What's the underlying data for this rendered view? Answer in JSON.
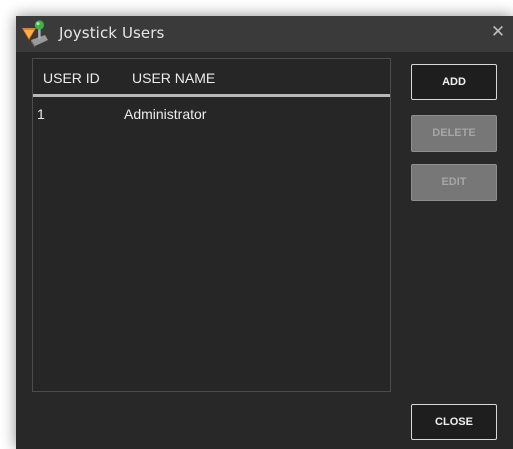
{
  "window": {
    "title": "Joystick Users",
    "close_glyph": "✕",
    "app_icon": "joystick-icon"
  },
  "user_list": {
    "columns": [
      "USER ID",
      "USER NAME"
    ],
    "rows": [
      {
        "user_id": "1",
        "user_name": "Administrator"
      }
    ]
  },
  "buttons": {
    "add": "ADD",
    "delete": "DELETE",
    "edit": "EDIT",
    "close": "CLOSE"
  },
  "colors": {
    "window_bg": "#282828",
    "titlebar_bg": "#3a3a3a",
    "header_underline": "#b8b8b8",
    "disabled_button": "#777777"
  }
}
